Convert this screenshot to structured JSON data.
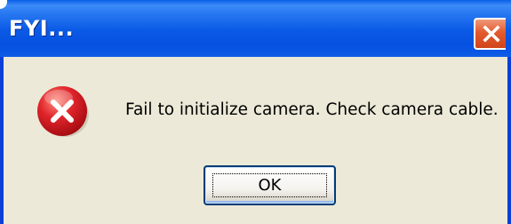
{
  "window": {
    "title": "FYI...",
    "message": "Fail to initialize camera. Check camera cable.",
    "ok_label": "OK",
    "icons": {
      "close": "close-icon",
      "status": "error-icon"
    },
    "colors": {
      "titlebar": "#0b5ae6",
      "close_button": "#e25a2e",
      "dialog_background": "#ece9d8",
      "error_icon": "#c8141a"
    }
  }
}
